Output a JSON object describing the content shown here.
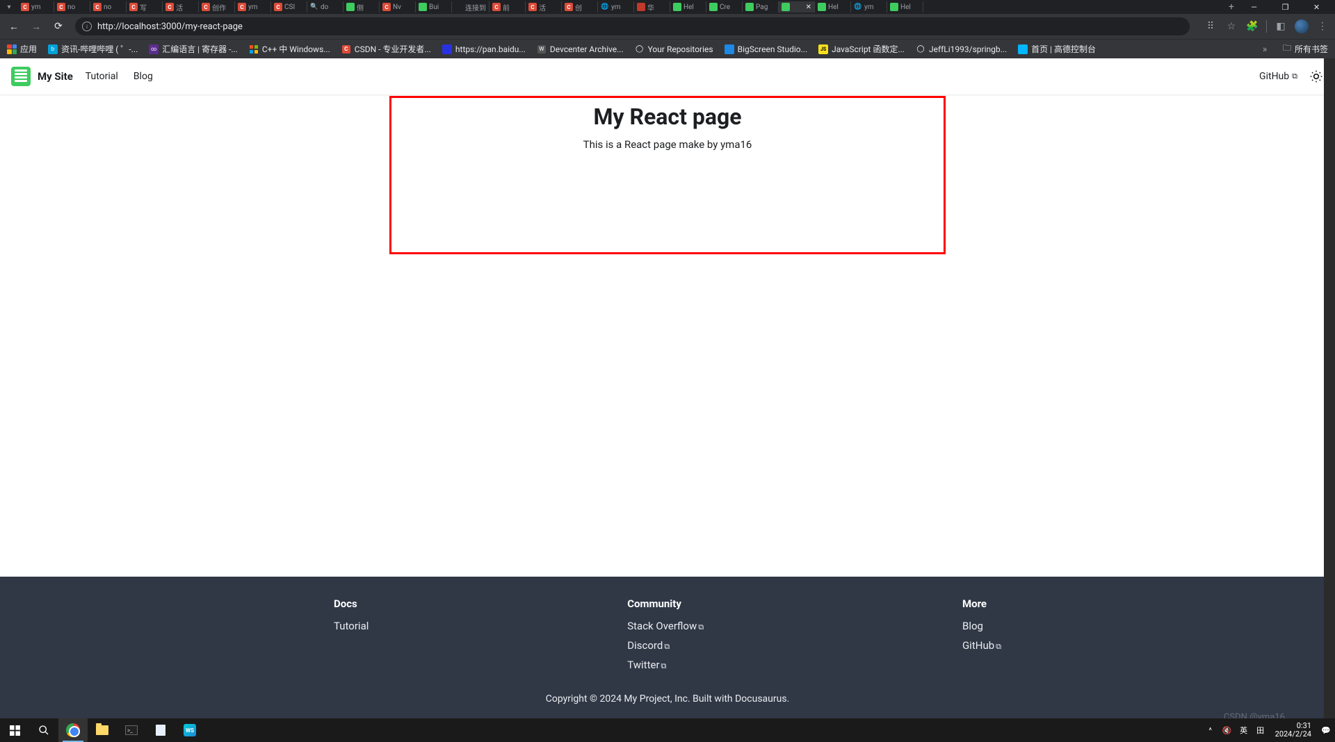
{
  "browser": {
    "tabs": [
      {
        "fav": "c",
        "text": "ym"
      },
      {
        "fav": "c",
        "text": "no"
      },
      {
        "fav": "c",
        "text": "no"
      },
      {
        "fav": "c",
        "text": "写"
      },
      {
        "fav": "c",
        "text": "活"
      },
      {
        "fav": "c",
        "text": "创作"
      },
      {
        "fav": "c",
        "text": "ym"
      },
      {
        "fav": "c",
        "text": "CSI"
      },
      {
        "fav": "search",
        "text": "do"
      },
      {
        "fav": "g",
        "text": "侧"
      },
      {
        "fav": "c",
        "text": "Nv"
      },
      {
        "fav": "g",
        "text": "Bui"
      },
      {
        "fav": "",
        "text": "连接到"
      },
      {
        "fav": "c",
        "text": "前"
      },
      {
        "fav": "c",
        "text": "活"
      },
      {
        "fav": "c",
        "text": "创"
      },
      {
        "fav": "globe",
        "text": "ym"
      },
      {
        "fav": "red",
        "text": "华"
      },
      {
        "fav": "g",
        "text": "Hel"
      },
      {
        "fav": "g",
        "text": "Cre"
      },
      {
        "fav": "g",
        "text": "Pag"
      },
      {
        "fav": "g",
        "text": "",
        "active": true
      },
      {
        "fav": "g",
        "text": "Hel"
      },
      {
        "fav": "globe",
        "text": "ym"
      },
      {
        "fav": "g",
        "text": "Hel"
      }
    ],
    "url": "http://localhost:3000/my-react-page",
    "bookmarks": [
      {
        "type": "apps",
        "text": "应用"
      },
      {
        "type": "bili",
        "text": "资讯-哔哩哔哩 ( ゜-..."
      },
      {
        "type": "vs",
        "text": "汇编语言 | 寄存器 -..."
      },
      {
        "type": "ms",
        "text": "C++ 中 Windows..."
      },
      {
        "type": "c",
        "text": "CSDN - 专业开发者..."
      },
      {
        "type": "bd",
        "text": "https://pan.baidu..."
      },
      {
        "type": "w",
        "text": "Devcenter Archive..."
      },
      {
        "type": "gh",
        "text": "Your Repositories"
      },
      {
        "type": "bs",
        "text": "BigScreen Studio..."
      },
      {
        "type": "js",
        "text": "JavaScript 函数定..."
      },
      {
        "type": "gh",
        "text": "JeffLi1993/springb..."
      },
      {
        "type": "gd",
        "text": "首页 | 高德控制台"
      }
    ],
    "all_bookmarks": "所有书签"
  },
  "site": {
    "title": "My Site",
    "nav": {
      "tutorial": "Tutorial",
      "blog": "Blog"
    },
    "github": "GitHub",
    "content": {
      "heading": "My React page",
      "paragraph": "This is a React page make by yma16"
    },
    "footer": {
      "col1": {
        "title": "Docs",
        "link1": "Tutorial"
      },
      "col2": {
        "title": "Community",
        "link1": "Stack Overflow",
        "link2": "Discord",
        "link3": "Twitter"
      },
      "col3": {
        "title": "More",
        "link1": "Blog",
        "link2": "GitHub"
      },
      "copyright": "Copyright © 2024 My Project, Inc. Built with Docusaurus."
    }
  },
  "taskbar": {
    "ime": "英",
    "ime2": "田",
    "time": "0:31",
    "date": "2024/2/24"
  },
  "watermark": "CSDN @yma16"
}
